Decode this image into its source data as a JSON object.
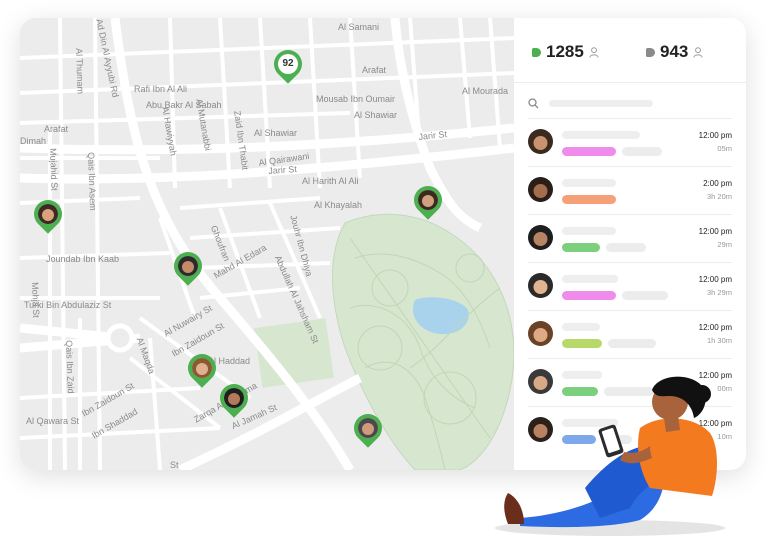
{
  "map": {
    "cluster_count": "92",
    "streets": [
      "Al Samani",
      "Ad Din Al Ayyubi Rd",
      "Rafi Ibn Al Ali",
      "Arafat",
      "Abu Bakr Al Sabah",
      "Al Hawiyyah",
      "Al Mutanabbi",
      "Zaid Ibn Thabit",
      "Mousab Ibn Oumair",
      "Al Shawiar",
      "Al Qairawani",
      "Al Shawiar",
      "Al Mourada",
      "Al Thumam",
      "Arafat",
      "Dimah",
      "Mujahid St",
      "Qais Ibn Asem",
      "Jarir St",
      "Jarir St",
      "Al Harith Al Ali",
      "Al Khayalah",
      "Jouhr Ibn Dhiya",
      "Ghoufran",
      "Mahd Al Edara",
      "Abdullah Al Jahsham St",
      "Joundab Ibn Kaab",
      "Mohja St",
      "Turki Bin Abdulaziz St",
      "Al Nuwairy St",
      "Ibn Zaidoun St",
      "Al Haddad",
      "Qais Ibn Zaid",
      "Al Maqda",
      "Al Qawara St",
      "Ibn Zaidoun St",
      "Ibn Shaddad",
      "Zarqa Al Yamama",
      "Al Jamah St",
      "St"
    ]
  },
  "stats": {
    "online": "1285",
    "offline": "943",
    "online_color": "#4caf50",
    "offline_color": "#8a8a8a",
    "user_icon": "user-icon"
  },
  "search": {
    "icon": "search-icon"
  },
  "list": [
    {
      "time": "12:00 pm",
      "duration": "05m",
      "tag_color": "#ef8bea"
    },
    {
      "time": "2:00 pm",
      "duration": "3h 20m",
      "tag_color": "#f6a07a"
    },
    {
      "time": "12:00 pm",
      "duration": "29m",
      "tag_color": "#7ccf7c"
    },
    {
      "time": "12:00 pm",
      "duration": "3h 29m",
      "tag_color": "#ef8bea"
    },
    {
      "time": "12:00 pm",
      "duration": "1h 30m",
      "tag_color": "#b8d86a"
    },
    {
      "time": "12:00 pm",
      "duration": "00m",
      "tag_color": "#7ccf7c"
    },
    {
      "time": "12:00 pm",
      "duration": "10m",
      "tag_color": "#7fa8ea"
    }
  ],
  "colors": {
    "park": "#d6e6cf",
    "road": "#ffffff",
    "marker": "#4caf50"
  }
}
